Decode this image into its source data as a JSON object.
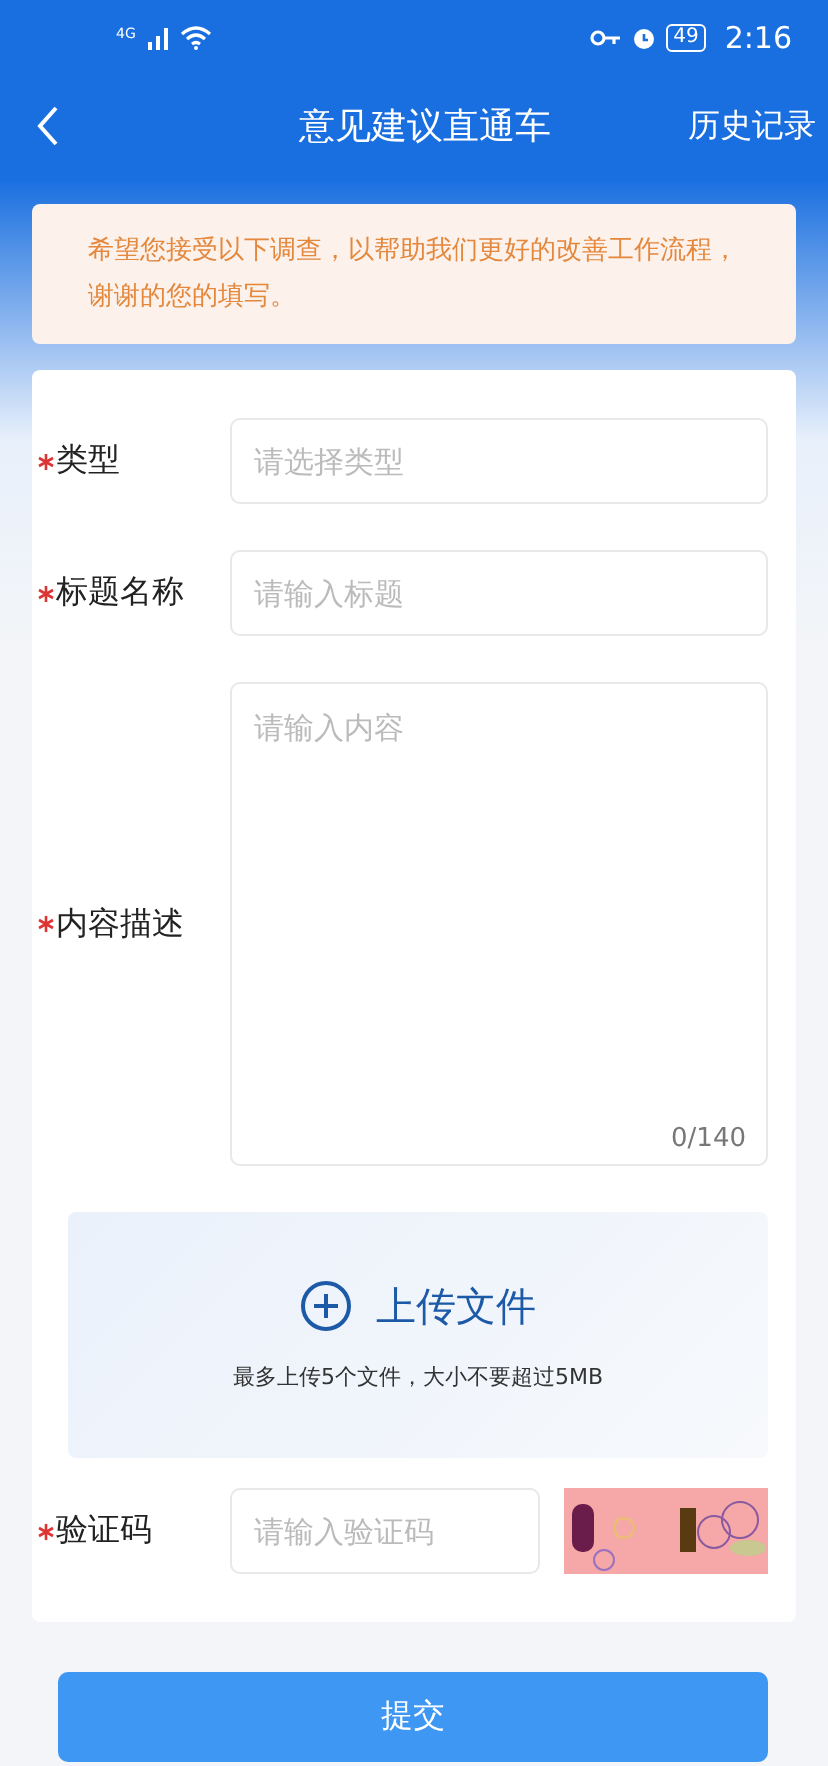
{
  "status_bar": {
    "network": "4G",
    "time": "2:16",
    "battery": "49"
  },
  "header": {
    "title": "意见建议直通车",
    "action": "历史记录"
  },
  "notice": "希望您接受以下调查，以帮助我们更好的改善工作流程，谢谢的您的填写。",
  "fields": [
    {
      "kind": "select",
      "label": "类型",
      "required": true,
      "placeholder": "请选择类型"
    },
    {
      "kind": "text",
      "label": "标题名称",
      "required": true,
      "placeholder": "请输入标题"
    },
    {
      "kind": "textarea",
      "label": "内容描述",
      "required": true,
      "placeholder": "请输入内容",
      "counter": "0/140"
    }
  ],
  "upload": {
    "title": "上传文件",
    "hint": "最多上传5个文件，大小不要超过5MB"
  },
  "captcha": {
    "label": "验证码",
    "required": true,
    "placeholder": "请输入验证码"
  },
  "submit": "提交"
}
